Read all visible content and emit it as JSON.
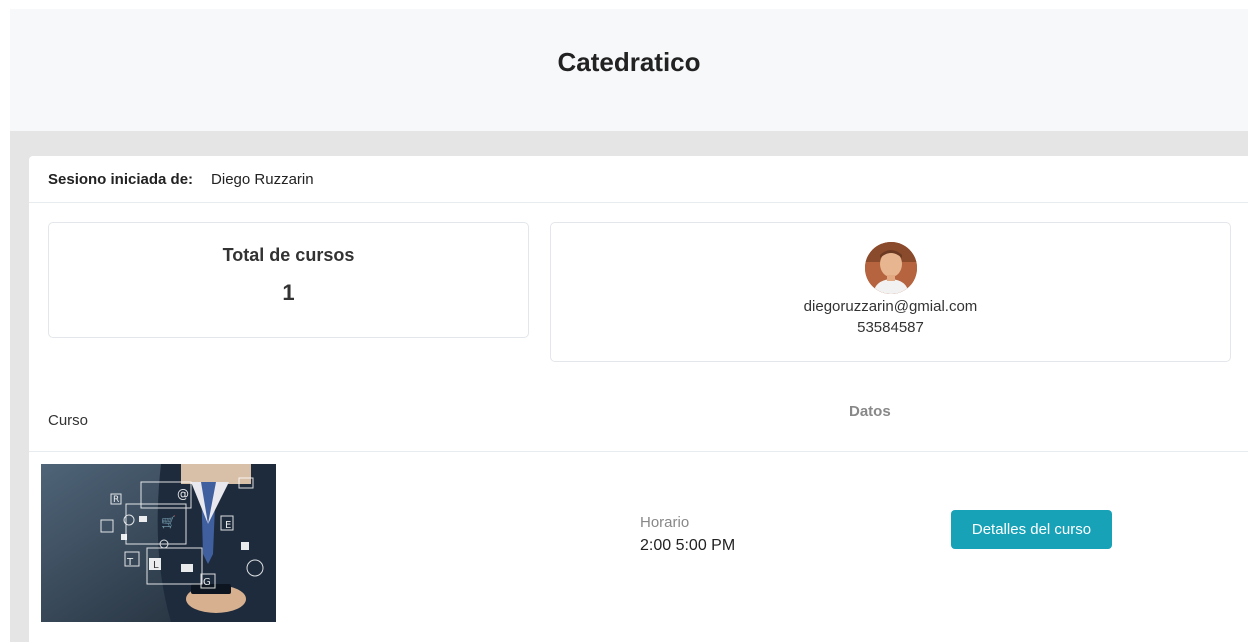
{
  "header": {
    "title": "Catedratico"
  },
  "session": {
    "label": "Sesiono iniciada de:",
    "name": "Diego Ruzzarin"
  },
  "stats": {
    "title": "Total de cursos",
    "count": "1"
  },
  "profile": {
    "email": "diegoruzzarin@gmial.com",
    "phone": "53584587"
  },
  "table": {
    "col_curso": "Curso",
    "col_datos": "Datos",
    "rows": [
      {
        "horario_label": "Horario",
        "horario_value": "2:00 5:00 PM",
        "button_label": "Detalles del curso"
      }
    ]
  },
  "colors": {
    "accent": "#17a2b8",
    "header_bg": "#f7f8fa",
    "band_bg": "#e5e5e5"
  }
}
